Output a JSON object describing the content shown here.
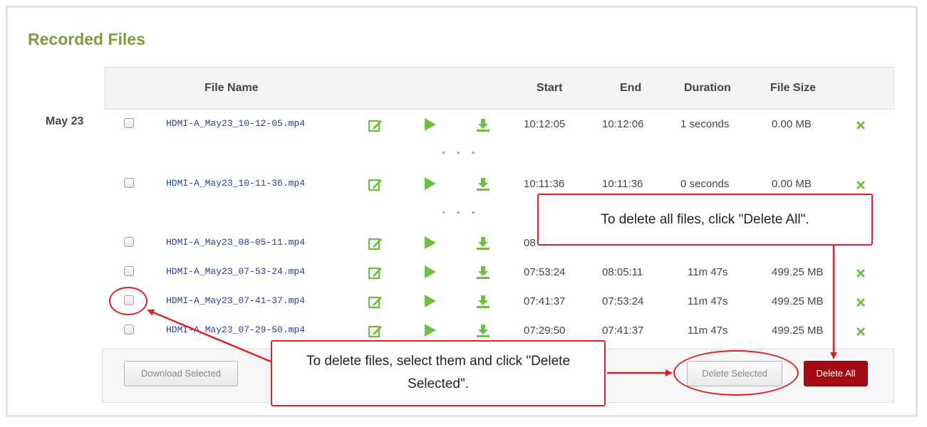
{
  "title": "Recorded Files",
  "columns": {
    "file_name": "File Name",
    "start": "Start",
    "end": "End",
    "duration": "Duration",
    "file_size": "File Size"
  },
  "date_group": "May 23",
  "ellipsis": "• • •",
  "rows": [
    {
      "file": "HDMI-A_May23_10-12-05.mp4",
      "start": "10:12:05",
      "end": "10:12:06",
      "duration": "1 seconds",
      "size": "0.00 MB"
    },
    {
      "file": "HDMI-A_May23_10-11-36.mp4",
      "start": "10:11:36",
      "end": "10:11:36",
      "duration": "0 seconds",
      "size": "0.00 MB"
    },
    {
      "file": "HDMI-A_May23_08-05-11.mp4",
      "start": "08",
      "end": "",
      "duration": "",
      "size": ""
    },
    {
      "file": "HDMI-A_May23_07-53-24.mp4",
      "start": "07:53:24",
      "end": "08:05:11",
      "duration": "11m 47s",
      "size": "499.25 MB"
    },
    {
      "file": "HDMI-A_May23_07-41-37.mp4",
      "start": "07:41:37",
      "end": "07:53:24",
      "duration": "11m 47s",
      "size": "499.25 MB"
    },
    {
      "file": "HDMI-A_May23_07-29-50.mp4",
      "start": "07:29:50",
      "end": "07:41:37",
      "duration": "11m 47s",
      "size": "499.25 MB"
    }
  ],
  "buttons": {
    "download_selected": "Download Selected",
    "delete_selected": "Delete Selected",
    "delete_all": "Delete All"
  },
  "callouts": {
    "delete_all": "To delete all files, click \"Delete All\".",
    "delete_selected": "To delete files, select them and click \"Delete Selected\"."
  },
  "colors": {
    "title": "#7a9e3c",
    "icon_green": "#6fbe44",
    "delete_all_bg": "#a40c14",
    "annotation_red": "#e02027"
  },
  "icons": [
    "edit-icon",
    "play-icon",
    "download-icon",
    "delete-x-icon"
  ]
}
